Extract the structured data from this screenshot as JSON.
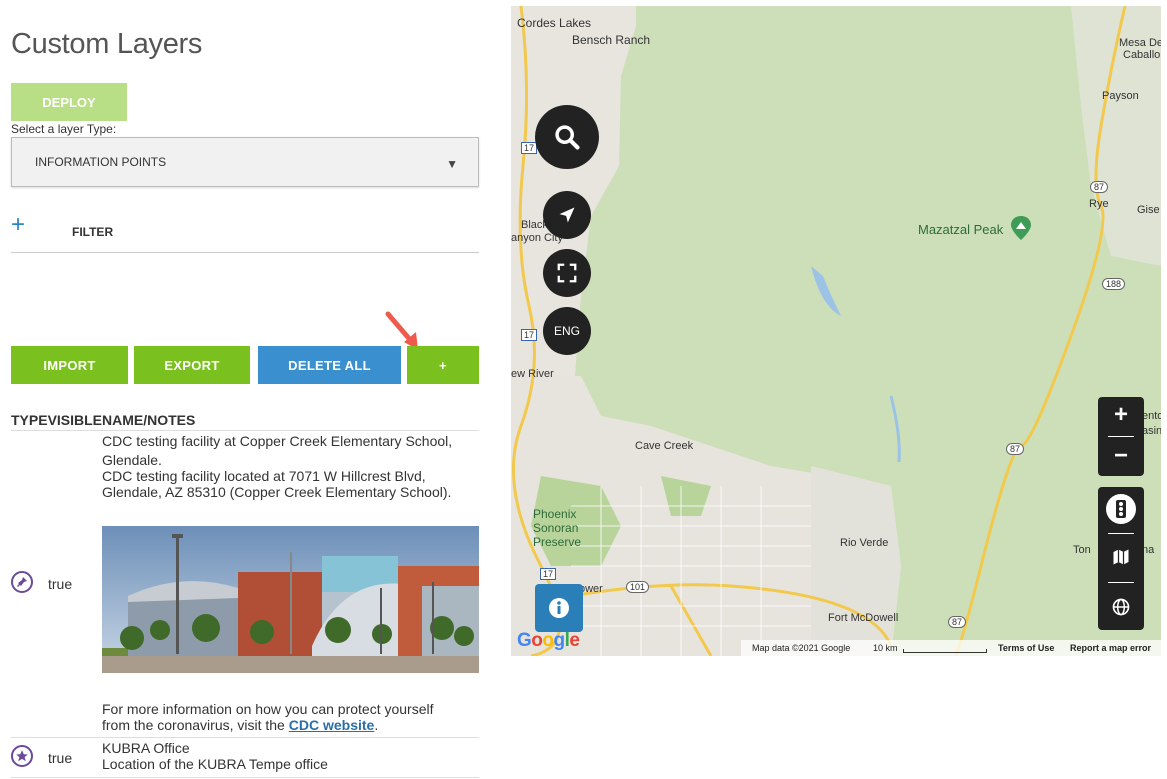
{
  "page": {
    "title": "Custom Layers"
  },
  "deploy": {
    "label": "DEPLOY"
  },
  "layer_type": {
    "label": "Select a layer Type:",
    "selected": "INFORMATION POINTS"
  },
  "filter": {
    "label": "FILTER"
  },
  "buttons": {
    "import": "IMPORT",
    "export": "EXPORT",
    "delete_all": "DELETE ALL",
    "add": "+"
  },
  "table": {
    "header": "TYPEVISIBLENAME/NOTES",
    "rows": [
      {
        "icon": "pin-icon",
        "visible": "true",
        "name_line1": "CDC testing facility at Copper Creek Elementary School,",
        "name_line2": "Glendale.",
        "desc_line1": "CDC testing facility located at 7071 W Hillcrest Blvd,",
        "desc_line2": "Glendale, AZ 85310 (Copper Creek Elementary School).",
        "more_line1": "For more information on how you can protect yourself",
        "more_line2_pre": "from the coronavirus, visit the ",
        "more_link": "CDC website",
        "more_line2_post": "."
      },
      {
        "icon": "star-icon",
        "visible": "true",
        "name_line1": "KUBRA Office",
        "desc_line1": "Location of the KUBRA Tempe office"
      }
    ]
  },
  "map": {
    "lang_label": "ENG",
    "labels": {
      "cordes_lakes": "Cordes Lakes",
      "bensch_ranch": "Bensch Ranch",
      "mesa_del": "Mesa De",
      "caballo": "Caballo",
      "payson": "Payson",
      "rye": "Rye",
      "gise": "Gise",
      "mazatzal_peak": "Mazatzal Peak",
      "black": "Black",
      "canyon_city": "anyon City",
      "new_river": "ew River",
      "cave_creek": "Cave Creek",
      "phoenix_sonoran": "Phoenix",
      "sonoran": "Sonoran",
      "preserve": "Preserve",
      "rio_verde": "Rio Verde",
      "fort_mcdowell": "Fort McDowell",
      "tonto": "Ton",
      "tonto_b": "na",
      "cento": "ento",
      "basin": "asin",
      "glower": "ower",
      "hw17a": "17",
      "hw17b": "17",
      "hw17c": "17",
      "hw87a": "87",
      "hw87b": "87",
      "hw87c": "87",
      "hw188": "188",
      "hw101": "101"
    },
    "footer": {
      "data": "Map data ©2021 Google",
      "scale": "10 km",
      "terms": "Terms of Use",
      "report": "Report a map error"
    },
    "google": "Google"
  },
  "colors": {
    "green_btn": "#7ac11f",
    "deploy_btn": "#b8de86",
    "blue_btn": "#3a90cf",
    "icon_purple": "#6b4a9b",
    "map_terrain": "#cfe0bd"
  }
}
